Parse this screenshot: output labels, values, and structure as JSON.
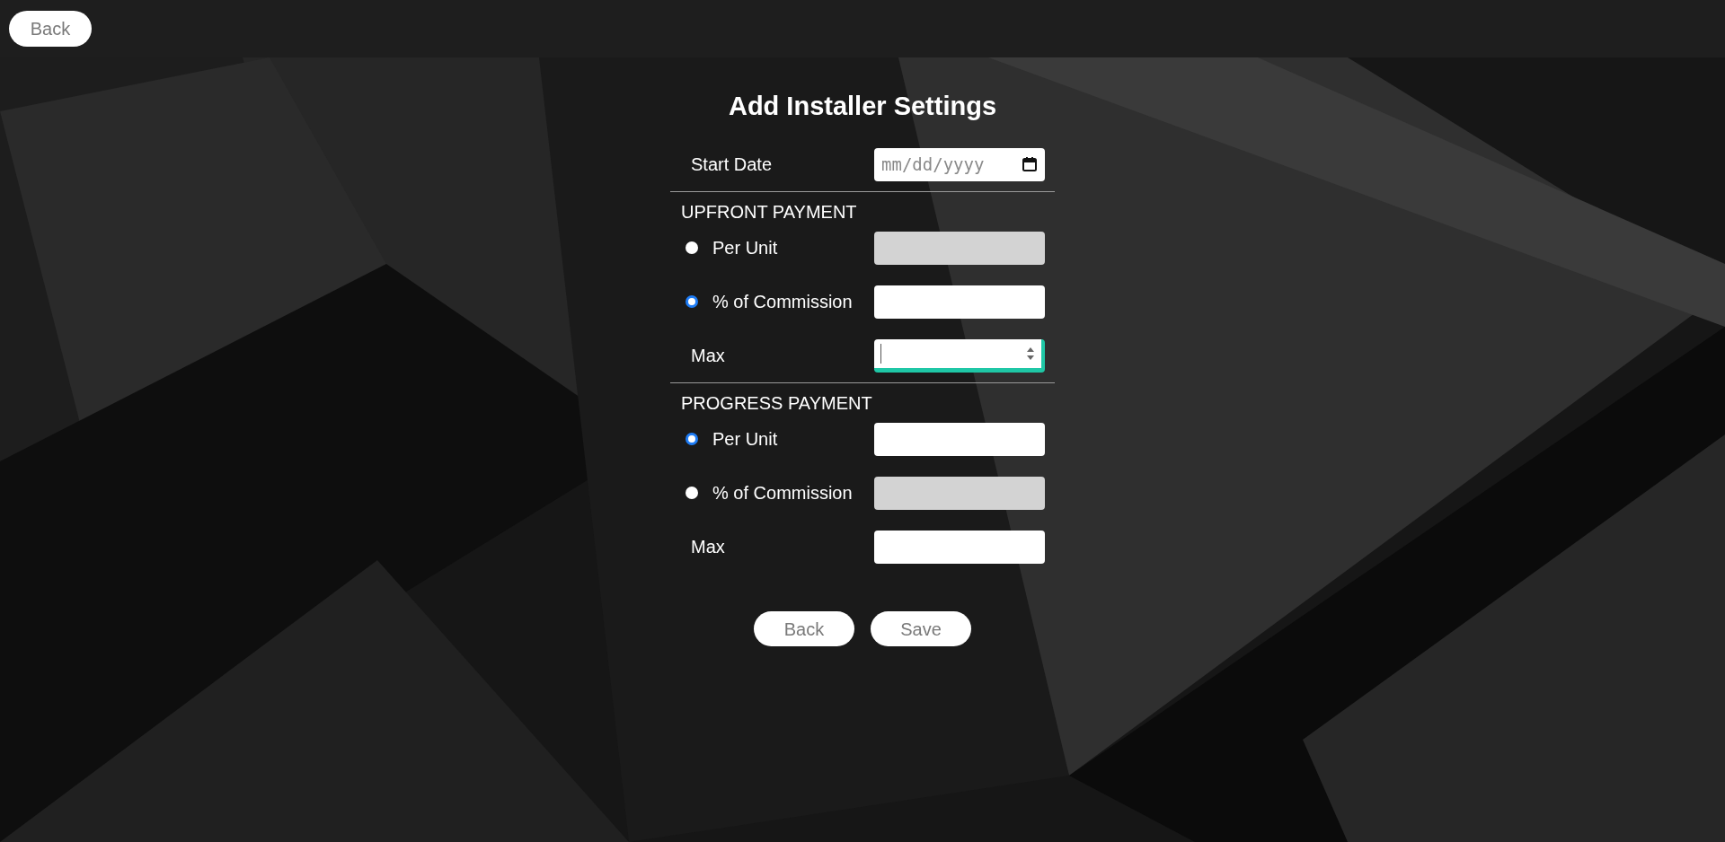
{
  "top_bar": {
    "back_button": "Back"
  },
  "title": "Add Installer Settings",
  "start_date": {
    "label": "Start Date",
    "placeholder": "mm/dd/yyyy"
  },
  "sections": [
    {
      "heading": "UPFRONT PAYMENT",
      "options": [
        {
          "label": "Per Unit",
          "selected": false
        },
        {
          "label": "% of Commission",
          "selected": true
        }
      ],
      "max": {
        "label": "Max",
        "focused": true
      }
    },
    {
      "heading": "PROGRESS PAYMENT",
      "options": [
        {
          "label": "Per Unit",
          "selected": true
        },
        {
          "label": "% of Commission",
          "selected": false
        }
      ],
      "max": {
        "label": "Max",
        "focused": false
      }
    }
  ],
  "buttons": [
    "Back",
    "Save"
  ]
}
